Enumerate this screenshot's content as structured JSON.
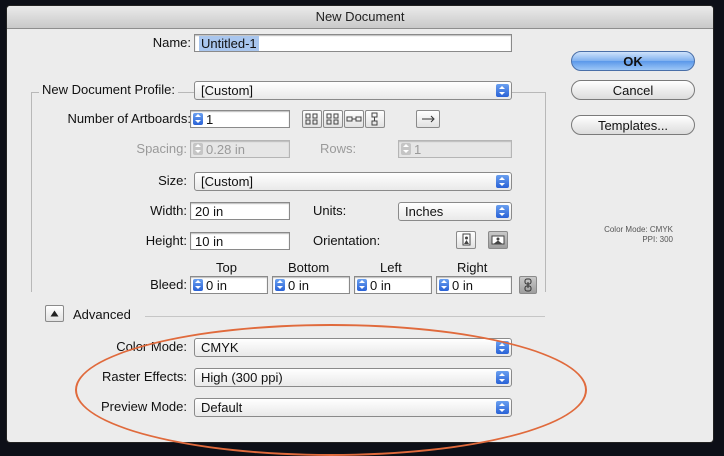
{
  "window": {
    "title": "New Document"
  },
  "name": {
    "label": "Name:",
    "value": "Untitled-1"
  },
  "profile": {
    "label": "New Document Profile:",
    "value": "[Custom]"
  },
  "artboards": {
    "label": "Number of Artboards:",
    "value": "1"
  },
  "spacing": {
    "label": "Spacing:",
    "value": "0.28 in"
  },
  "rows": {
    "label": "Rows:",
    "value": "1"
  },
  "size": {
    "label": "Size:",
    "value": "[Custom]"
  },
  "width": {
    "label": "Width:",
    "value": "20 in"
  },
  "units": {
    "label": "Units:",
    "value": "Inches"
  },
  "height": {
    "label": "Height:",
    "value": "10 in"
  },
  "orientation": {
    "label": "Orientation:"
  },
  "bleed": {
    "label": "Bleed:",
    "top_label": "Top",
    "bottom_label": "Bottom",
    "left_label": "Left",
    "right_label": "Right",
    "top": "0 in",
    "bottom": "0 in",
    "left": "0 in",
    "right": "0 in"
  },
  "advanced": {
    "label": "Advanced"
  },
  "color_mode": {
    "label": "Color Mode:",
    "value": "CMYK"
  },
  "raster_effects": {
    "label": "Raster Effects:",
    "value": "High (300 ppi)"
  },
  "preview_mode": {
    "label": "Preview Mode:",
    "value": "Default"
  },
  "buttons": {
    "ok": "OK",
    "cancel": "Cancel",
    "templates": "Templates..."
  },
  "info": {
    "line1": "Color Mode: CMYK",
    "line2": "PPI: 300"
  },
  "colors": {
    "accent": "#5b98ea",
    "highlight": "#e06a3c"
  }
}
